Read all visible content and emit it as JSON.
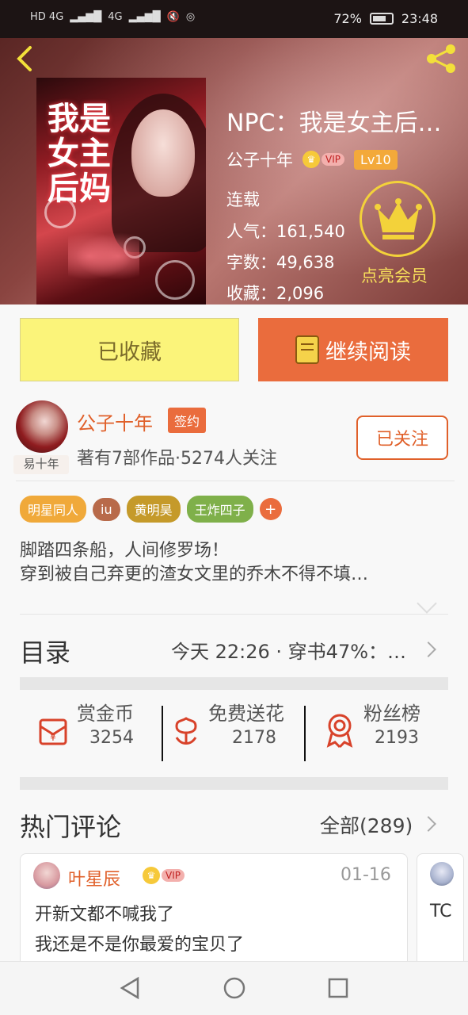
{
  "status_bar": {
    "signal_left": "HD 4G",
    "network": "4G",
    "battery_percent": "72%",
    "time": "23:48"
  },
  "header": {
    "back_icon": "chevron-left-icon",
    "share_icon": "share-icon",
    "book_title": "NPC：我是女主后…",
    "author": "公子十年",
    "vip_label": "VIP",
    "level": "Lv10",
    "status": "连载",
    "popularity_label": "人气：",
    "popularity": "161,540",
    "words_label": "字数：",
    "words": "49,638",
    "favorites_label": "收藏：",
    "favorites": "2,096",
    "member_label": "点亮会员",
    "accent_color": "#f3d23a"
  },
  "cover": {
    "art_text": "我是女主后妈"
  },
  "actions": {
    "collected_label": "已收藏",
    "continue_label": "继续阅读"
  },
  "author_section": {
    "avatar_caption": "易十年",
    "name": "公子十年",
    "sign_badge": "签约",
    "stats": "著有7部作品·5274人关注",
    "follow_label": "已关注"
  },
  "tags": [
    {
      "label": "明星同人",
      "color": "#f0a93a"
    },
    {
      "label": "iu",
      "color": "#b86a4a"
    },
    {
      "label": "黄明昊",
      "color": "#c59a2a"
    },
    {
      "label": "王炸四子",
      "color": "#7fb04a"
    }
  ],
  "tag_add": "+",
  "description": {
    "line1": "脚踏四条船，人间修罗场！",
    "line2": "穿到被自己弃更的渣女文里的乔木不得不填…"
  },
  "toc": {
    "title": "目录",
    "latest": "今天 22:26 · 穿书47%：…"
  },
  "stats": {
    "reward": {
      "label": "赏金币",
      "value": "3254",
      "icon": "red-envelope-icon"
    },
    "flower": {
      "label": "免费送花",
      "value": "2178",
      "icon": "flower-icon"
    },
    "fans": {
      "label": "粉丝榜",
      "value": "2193",
      "icon": "medal-icon"
    }
  },
  "hot_comments": {
    "title": "热门评论",
    "all_label": "全部(289)",
    "comments": [
      {
        "name": "叶星辰",
        "vip": "VIP",
        "date": "01-16",
        "line1": "开新文都不喊我了",
        "line2": "我还是不是你最爱的宝贝了"
      },
      {
        "snippet": "TC"
      }
    ]
  },
  "nav": {
    "back": "back-triangle-icon",
    "home": "home-circle-icon",
    "recents": "recents-square-icon"
  }
}
